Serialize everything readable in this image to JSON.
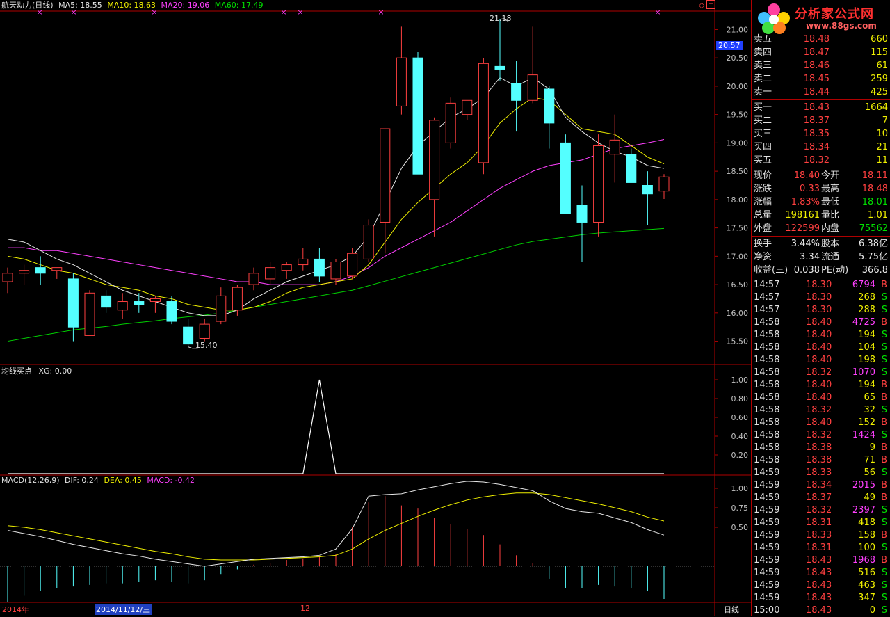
{
  "header": {
    "title": "航天动力(日线)",
    "ma5": "MA5: 18.55",
    "ma10": "MA10: 18.63",
    "ma20": "MA20: 19.06",
    "ma60": "MA60: 17.49"
  },
  "axis": {
    "price_ticks": [
      "21.00",
      "20.50",
      "20.00",
      "19.50",
      "19.00",
      "18.50",
      "18.00",
      "17.50",
      "17.00",
      "16.50",
      "16.00",
      "15.50"
    ],
    "current_price_tag": "20.57",
    "ind_ticks": [
      "1.00",
      "0.80",
      "0.60",
      "0.40",
      "0.20"
    ],
    "macd_ticks": [
      "1.00",
      "0.75",
      "0.50"
    ]
  },
  "annotations": {
    "high": "21.18",
    "low": "15.40"
  },
  "indicator": {
    "label": "均线买点",
    "xg": "XG: 0.00"
  },
  "macd": {
    "label": "MACD(12,26,9)",
    "dif": "DIF: 0.24",
    "dea": "DEA: 0.45",
    "macd": "MACD: -0.42"
  },
  "footer": {
    "year": "2014年",
    "date": "2014/11/12/三",
    "month": "12",
    "period": "日线"
  },
  "colors": {
    "up": "#ff4040",
    "down": "#54ffff",
    "ma5": "#e8e8e8",
    "ma10": "#f0f000",
    "ma20": "#ff40ff",
    "ma60": "#00d000",
    "frame": "#b00000"
  },
  "chart_data": {
    "type": "candlestick",
    "ylim": [
      15.2,
      21.3
    ],
    "candles": [
      [
        16.55,
        16.8,
        16.35,
        16.7
      ],
      [
        16.7,
        16.85,
        16.5,
        16.75
      ],
      [
        16.8,
        17.0,
        16.5,
        16.7
      ],
      [
        16.75,
        16.8,
        16.6,
        16.8
      ],
      [
        16.6,
        16.7,
        15.5,
        15.75
      ],
      [
        15.6,
        16.4,
        15.6,
        16.35
      ],
      [
        16.3,
        16.4,
        16.0,
        16.1
      ],
      [
        16.05,
        16.35,
        15.9,
        16.2
      ],
      [
        16.2,
        16.35,
        16.0,
        16.15
      ],
      [
        16.2,
        16.3,
        16.0,
        16.25
      ],
      [
        16.2,
        16.3,
        15.8,
        15.85
      ],
      [
        15.75,
        15.9,
        15.4,
        15.45
      ],
      [
        15.55,
        15.9,
        15.5,
        15.8
      ],
      [
        15.85,
        16.45,
        15.8,
        16.3
      ],
      [
        16.05,
        16.5,
        15.95,
        16.45
      ],
      [
        16.5,
        16.8,
        16.4,
        16.7
      ],
      [
        16.6,
        16.9,
        16.5,
        16.8
      ],
      [
        16.75,
        16.9,
        16.6,
        16.85
      ],
      [
        16.85,
        17.15,
        16.75,
        16.95
      ],
      [
        16.95,
        17.15,
        16.55,
        16.65
      ],
      [
        16.6,
        16.95,
        16.5,
        16.9
      ],
      [
        16.65,
        17.15,
        16.6,
        17.05
      ],
      [
        16.95,
        17.65,
        16.9,
        17.55
      ],
      [
        17.6,
        19.25,
        17.05,
        19.25
      ],
      [
        19.65,
        21.05,
        19.5,
        20.5
      ],
      [
        20.5,
        20.6,
        18.45,
        18.45
      ],
      [
        18.0,
        19.45,
        17.35,
        19.4
      ],
      [
        19.0,
        19.8,
        18.9,
        19.7
      ],
      [
        19.5,
        19.75,
        19.4,
        19.75
      ],
      [
        18.65,
        20.5,
        18.45,
        20.4
      ],
      [
        20.35,
        21.18,
        20.1,
        20.3
      ],
      [
        20.05,
        20.45,
        19.2,
        19.75
      ],
      [
        19.75,
        21.05,
        19.7,
        20.2
      ],
      [
        19.95,
        20.0,
        18.9,
        19.35
      ],
      [
        19.0,
        19.15,
        17.8,
        17.75
      ],
      [
        17.9,
        18.25,
        16.9,
        17.6
      ],
      [
        17.6,
        19.15,
        17.35,
        18.95
      ],
      [
        18.8,
        19.5,
        18.3,
        19.05
      ],
      [
        18.8,
        18.9,
        18.5,
        18.3
      ],
      [
        18.25,
        18.5,
        17.55,
        18.1
      ],
      [
        18.15,
        18.45,
        18.01,
        18.4
      ]
    ],
    "ma5": [
      17.3,
      17.25,
      17.1,
      16.95,
      16.85,
      16.7,
      16.55,
      16.4,
      16.3,
      16.2,
      16.1,
      16.0,
      15.95,
      15.95,
      16.05,
      16.25,
      16.4,
      16.55,
      16.65,
      16.75,
      16.85,
      17.0,
      17.35,
      17.95,
      18.55,
      18.95,
      19.2,
      19.45,
      19.6,
      19.8,
      20.15,
      20.0,
      20.15,
      19.95,
      19.45,
      19.2,
      19.0,
      18.85,
      18.75,
      18.6,
      18.55
    ],
    "ma10": [
      17.0,
      16.95,
      16.85,
      16.75,
      16.7,
      16.6,
      16.5,
      16.45,
      16.4,
      16.3,
      16.25,
      16.15,
      16.1,
      16.05,
      16.05,
      16.1,
      16.2,
      16.35,
      16.45,
      16.5,
      16.55,
      16.6,
      16.85,
      17.25,
      17.65,
      17.95,
      18.2,
      18.45,
      18.65,
      18.95,
      19.35,
      19.6,
      19.8,
      19.75,
      19.5,
      19.25,
      19.2,
      19.15,
      18.95,
      18.75,
      18.63
    ],
    "ma20": [
      17.15,
      17.15,
      17.1,
      17.1,
      17.05,
      17.0,
      16.95,
      16.9,
      16.85,
      16.8,
      16.75,
      16.7,
      16.65,
      16.6,
      16.55,
      16.55,
      16.5,
      16.5,
      16.5,
      16.5,
      16.55,
      16.65,
      16.8,
      17.0,
      17.15,
      17.3,
      17.45,
      17.6,
      17.8,
      18.0,
      18.2,
      18.35,
      18.5,
      18.6,
      18.65,
      18.7,
      18.8,
      18.9,
      18.95,
      19.0,
      19.06
    ],
    "ma60": [
      15.5,
      15.55,
      15.6,
      15.65,
      15.7,
      15.73,
      15.76,
      15.8,
      15.83,
      15.86,
      15.9,
      15.93,
      15.96,
      16.0,
      16.05,
      16.1,
      16.15,
      16.2,
      16.25,
      16.3,
      16.35,
      16.4,
      16.48,
      16.56,
      16.64,
      16.72,
      16.8,
      16.88,
      16.96,
      17.04,
      17.12,
      17.2,
      17.26,
      17.3,
      17.34,
      17.38,
      17.41,
      17.43,
      17.45,
      17.47,
      17.49
    ],
    "xg": [
      0,
      0,
      0,
      0,
      0,
      0,
      0,
      0,
      0,
      0,
      0,
      0,
      0,
      0,
      0,
      0,
      0,
      0,
      0,
      1,
      0,
      0,
      0,
      0,
      0,
      0,
      0,
      0,
      0,
      0,
      0,
      0,
      0,
      0,
      0,
      0,
      0,
      0,
      0,
      0,
      0
    ],
    "dif": [
      0.46,
      0.42,
      0.38,
      0.33,
      0.28,
      0.24,
      0.2,
      0.16,
      0.13,
      0.09,
      0.06,
      0.03,
      0.0,
      0.03,
      0.06,
      0.09,
      0.1,
      0.11,
      0.12,
      0.14,
      0.22,
      0.48,
      0.9,
      0.92,
      0.93,
      0.98,
      1.02,
      1.06,
      1.09,
      1.08,
      1.05,
      1.01,
      0.97,
      0.84,
      0.74,
      0.7,
      0.68,
      0.62,
      0.56,
      0.47,
      0.4
    ],
    "dea": [
      0.52,
      0.5,
      0.47,
      0.43,
      0.39,
      0.35,
      0.31,
      0.27,
      0.23,
      0.19,
      0.16,
      0.12,
      0.09,
      0.08,
      0.08,
      0.08,
      0.09,
      0.1,
      0.11,
      0.12,
      0.14,
      0.22,
      0.35,
      0.46,
      0.55,
      0.64,
      0.72,
      0.79,
      0.85,
      0.89,
      0.92,
      0.94,
      0.94,
      0.92,
      0.88,
      0.84,
      0.8,
      0.75,
      0.7,
      0.63,
      0.58
    ],
    "macd_hist": [
      -0.46,
      -0.38,
      -0.32,
      -0.28,
      -0.26,
      -0.24,
      -0.22,
      -0.22,
      -0.2,
      -0.18,
      -0.2,
      -0.22,
      -0.18,
      -0.1,
      -0.04,
      0.02,
      0.04,
      0.08,
      0.1,
      0.12,
      0.16,
      0.5,
      0.82,
      0.9,
      0.78,
      0.74,
      0.62,
      0.54,
      0.48,
      0.4,
      0.28,
      0.14,
      0.04,
      -0.16,
      -0.28,
      -0.28,
      -0.24,
      -0.26,
      -0.28,
      -0.32,
      -0.42
    ]
  },
  "quote": {
    "asks": [
      {
        "label": "卖五",
        "price": "18.48",
        "vol": "660"
      },
      {
        "label": "卖四",
        "price": "18.47",
        "vol": "115"
      },
      {
        "label": "卖三",
        "price": "18.46",
        "vol": "61"
      },
      {
        "label": "卖二",
        "price": "18.45",
        "vol": "259"
      },
      {
        "label": "卖一",
        "price": "18.44",
        "vol": "425"
      }
    ],
    "bids": [
      {
        "label": "买一",
        "price": "18.43",
        "vol": "1664"
      },
      {
        "label": "买二",
        "price": "18.37",
        "vol": "7"
      },
      {
        "label": "买三",
        "price": "18.35",
        "vol": "10"
      },
      {
        "label": "买四",
        "price": "18.34",
        "vol": "21"
      },
      {
        "label": "买五",
        "price": "18.32",
        "vol": "11"
      }
    ],
    "stats": [
      {
        "l1": "现价",
        "v1": "18.40",
        "l2": "今开",
        "v2": "18.11"
      },
      {
        "l1": "涨跌",
        "v1": "0.33",
        "l2": "最高",
        "v2": "18.48"
      },
      {
        "l1": "涨幅",
        "v1": "1.83%",
        "l2": "最低",
        "v2": "18.01"
      },
      {
        "l1": "总量",
        "v1": "198161",
        "l2": "量比",
        "v2": "1.01"
      },
      {
        "l1": "外盘",
        "v1": "122599",
        "l2": "内盘",
        "v2": "75562"
      }
    ],
    "stats2": [
      {
        "l1": "换手",
        "v1": "3.44%",
        "l2": "股本",
        "v2": "6.38亿"
      },
      {
        "l1": "净资",
        "v1": "3.34",
        "l2": "流通",
        "v2": "5.75亿"
      },
      {
        "l1": "收益(三)",
        "v1": "0.038",
        "l2": "PE(动)",
        "v2": "366.8"
      }
    ]
  },
  "ticks": [
    {
      "time": "14:57",
      "price": "18.30",
      "vol": "6794",
      "side": "B"
    },
    {
      "time": "14:57",
      "price": "18.30",
      "vol": "268",
      "side": "S"
    },
    {
      "time": "14:57",
      "price": "18.30",
      "vol": "288",
      "side": "S"
    },
    {
      "time": "14:58",
      "price": "18.40",
      "vol": "4725",
      "side": "B"
    },
    {
      "time": "14:58",
      "price": "18.40",
      "vol": "194",
      "side": "S"
    },
    {
      "time": "14:58",
      "price": "18.40",
      "vol": "104",
      "side": "S"
    },
    {
      "time": "14:58",
      "price": "18.40",
      "vol": "198",
      "side": "S"
    },
    {
      "time": "14:58",
      "price": "18.32",
      "vol": "1070",
      "side": "S"
    },
    {
      "time": "14:58",
      "price": "18.40",
      "vol": "194",
      "side": "B"
    },
    {
      "time": "14:58",
      "price": "18.40",
      "vol": "65",
      "side": "B"
    },
    {
      "time": "14:58",
      "price": "18.32",
      "vol": "32",
      "side": "S"
    },
    {
      "time": "14:58",
      "price": "18.40",
      "vol": "152",
      "side": "B"
    },
    {
      "time": "14:58",
      "price": "18.32",
      "vol": "1424",
      "side": "S"
    },
    {
      "time": "14:58",
      "price": "18.38",
      "vol": "9",
      "side": "B"
    },
    {
      "time": "14:58",
      "price": "18.38",
      "vol": "71",
      "side": "B"
    },
    {
      "time": "14:59",
      "price": "18.33",
      "vol": "56",
      "side": "S"
    },
    {
      "time": "14:59",
      "price": "18.34",
      "vol": "2015",
      "side": "B"
    },
    {
      "time": "14:59",
      "price": "18.37",
      "vol": "49",
      "side": "B"
    },
    {
      "time": "14:59",
      "price": "18.32",
      "vol": "2397",
      "side": "S"
    },
    {
      "time": "14:59",
      "price": "18.31",
      "vol": "418",
      "side": "S"
    },
    {
      "time": "14:59",
      "price": "18.33",
      "vol": "158",
      "side": "B"
    },
    {
      "time": "14:59",
      "price": "18.31",
      "vol": "100",
      "side": "S"
    },
    {
      "time": "14:59",
      "price": "18.43",
      "vol": "1968",
      "side": "B"
    },
    {
      "time": "14:59",
      "price": "18.43",
      "vol": "516",
      "side": "S"
    },
    {
      "time": "14:59",
      "price": "18.43",
      "vol": "463",
      "side": "S"
    },
    {
      "time": "14:59",
      "price": "18.43",
      "vol": "347",
      "side": "S"
    },
    {
      "time": "15:00",
      "price": "18.43",
      "vol": "0",
      "side": "S"
    }
  ],
  "logo": {
    "text": "分析家公式网",
    "url": "www.88gs.com"
  }
}
